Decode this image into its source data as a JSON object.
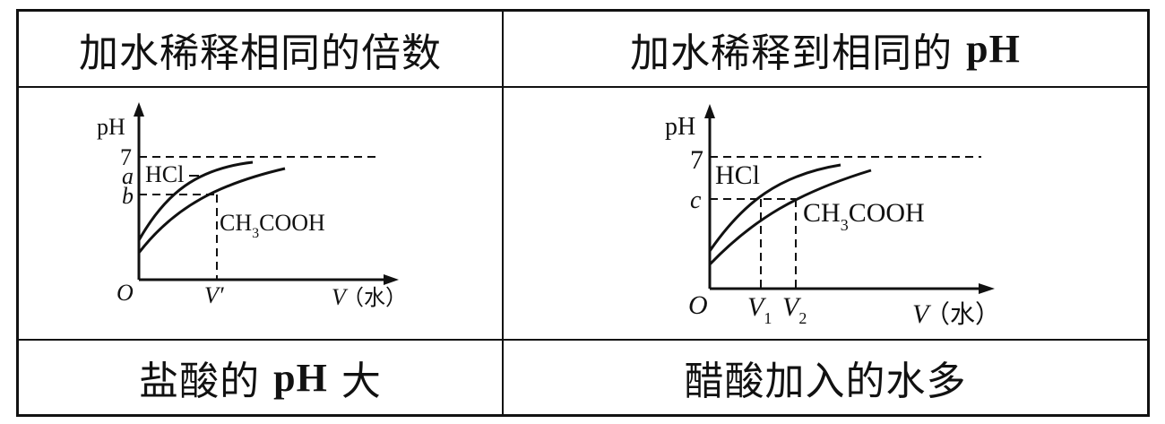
{
  "table": {
    "header": [
      {
        "prefix": "加水稀释相同的倍数",
        "suffix": ""
      },
      {
        "prefix": "加水稀释到相同的 ",
        "suffix": "pH"
      }
    ],
    "conclusion": [
      {
        "prefix": "盐酸的 ",
        "latin": "pH",
        "suffix": " 大"
      },
      {
        "prefix": "醋酸加入的水多",
        "latin": "",
        "suffix": ""
      }
    ]
  },
  "diagrams": [
    {
      "y_axis_label": "pH",
      "x_axis_label_var": "V",
      "x_axis_label_unit": "（水）",
      "origin": "O",
      "y_ticks": [
        "7",
        "a",
        "b"
      ],
      "x_ticks": [
        "V′"
      ],
      "curve_labels": [
        "HCl",
        "CH",
        "3",
        "COOH"
      ]
    },
    {
      "y_axis_label": "pH",
      "x_axis_label_var": "V",
      "x_axis_label_unit": "（水）",
      "origin": "O",
      "y_ticks": [
        "7",
        "c"
      ],
      "x_ticks": [
        {
          "main": "V",
          "sub": "1"
        },
        {
          "main": "V",
          "sub": "2"
        }
      ],
      "curve_labels": [
        "HCl",
        "CH",
        "3",
        "COOH"
      ]
    }
  ],
  "colors": {
    "ink": "#111111",
    "background": "#ffffff"
  }
}
